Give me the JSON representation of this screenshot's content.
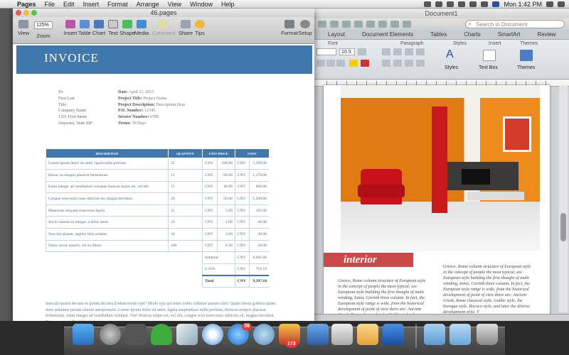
{
  "menubar": {
    "app": "Pages",
    "items": [
      "File",
      "Edit",
      "Insert",
      "Format",
      "Arrange",
      "View",
      "Window",
      "Help"
    ],
    "clock": "Mon 1:42 PM"
  },
  "pages_window": {
    "title": "46.pages",
    "toolbar": {
      "view": "View",
      "zoom_value": "125%",
      "zoom": "Zoom",
      "insert": "Insert",
      "table": "Table",
      "chart": "Chart",
      "text": "Text",
      "shape": "Shape",
      "media": "Media",
      "comment": "Comment",
      "share": "Share",
      "tips": "Tips",
      "format": "Format",
      "setup": "Setup"
    },
    "invoice": {
      "title": "INVOICE",
      "to_lines": [
        "To:",
        "First Last",
        "Title",
        "Company Name",
        "1321 First Street",
        "Anytown, State ZIP"
      ],
      "meta_lines": [
        {
          "label": "Date:",
          "value": "April 12, 2013"
        },
        {
          "label": "Project Title:",
          "value": "Project Name"
        },
        {
          "label": "Project Description:",
          "value": "Description Here"
        },
        {
          "label": "P.O. Number:",
          "value": "12345"
        },
        {
          "label": "Invoice Number:",
          "value": "6789"
        },
        {
          "label": "Terms:",
          "value": "30 Days"
        }
      ],
      "headers": [
        "DESCRIPTION",
        "QUANTITY",
        "UNIT PRICE",
        "COST"
      ],
      "rows": [
        {
          "desc": "Lorem ipsum dolor sit amet, ligula nulla pretium",
          "qty": "55",
          "cur1": "CNY",
          "unit": "100.00",
          "cur2": "CNY",
          "cost": "5,500.00"
        },
        {
          "desc": "Rhonc us tempor placerat fermentum",
          "qty": "13",
          "cur1": "CNY",
          "unit": "90.00",
          "cur2": "CNY",
          "cost": "1,170.00"
        },
        {
          "desc": "Enim integer ad vestibulum volutpat rhoncus turpis est, vel elit",
          "qty": "15",
          "cur1": "CNY",
          "unit": "40.00",
          "cur2": "CNY",
          "cost": "600.00"
        },
        {
          "desc": "Congue wisi enim nunc ultricies sit, magna tincidunt",
          "qty": "24",
          "cur1": "CNY",
          "unit": "50.00",
          "cur2": "CNY",
          "cost": "1,200.00"
        },
        {
          "desc": "Maecenas aliquam maecenas ligula",
          "qty": "21",
          "cur1": "CNY",
          "unit": "5.00",
          "cur2": "CNY",
          "cost": "105.00"
        },
        {
          "desc": "Sociis mauris in integer, a dolor netus",
          "qty": "23",
          "cur1": "CNY",
          "unit": "2.00",
          "cur2": "CNY",
          "cost": "46.00"
        },
        {
          "desc": "Non dui aliquet, sagittis felis sodales",
          "qty": "10",
          "cur1": "CNY",
          "unit": "3.00",
          "cur2": "CNY",
          "cost": "30.00"
        },
        {
          "desc": "Dolor sociis mauris, vel eu libero",
          "qty": "100",
          "cur1": "CNY",
          "unit": "0.30",
          "cur2": "CNY",
          "cost": "30.00"
        }
      ],
      "subtotal_label": "Subtotal",
      "subtotal_cur": "CNY",
      "subtotal": "8,681.00",
      "tax_label": "8.25%",
      "tax_cur": "CNY",
      "tax": "716.18",
      "total_label": "Total",
      "total_cur": "CNY",
      "total": "9,397.18",
      "body_text": "Seacula quarta decima et quinta decima Eodem modo typi? Modo typi qui nunc nobis videntur parum clari. Quam littera gothica quam nunc putamus parum claram anteposuerit. Lorem ipsum dolor sit amet, ligula suspendisse nulla pretium, rhoncus tempor placerat fermentum, enim integer ad vestibulum volutpat. Nisl rhoncus turpis est, vel elit, congue wisi enim nunc ultricies sit, magna tincidunt. Duis montes, tellus lobortis lacus amet arcu et"
    }
  },
  "word_window": {
    "title": "Document1",
    "search_placeholder": "Search in Document",
    "tabs": [
      "Layout",
      "Document Elements",
      "Tables",
      "Charts",
      "SmartArt",
      "Review"
    ],
    "ribbon": {
      "font": "Font",
      "paragraph": "Paragraph",
      "styles": "Styles",
      "insert": "Insert",
      "themes": "Themes",
      "font_size": "10.5",
      "styles_btn": "Styles",
      "text_box": "Text Box",
      "themes_btn": "Themes"
    },
    "banner": "interior",
    "col_left": "Greece, Rome column structure of European style in the concept of people the most typical, see European style building the first thought of multi winding, Ionia, Corinth three column. In fact, the European style range is wide, from the historical development of point of view there are: Ancient Greek, Rome classical style, Gothic style, the baroque style, Rococo style and later",
    "col_right": "Greece, Rome column structure of European style in the concept of people the most typical, see European style building the first thought of multi winding, Ionia, Corinth three column. In fact, the European style range is wide, from the historical development of point of view there are: Ancient Greek, Rome classical style, Gothic style, the baroque style, Rococo style, and later the diverse development style. Y"
  },
  "dock": {
    "badges": {
      "appstore": "38",
      "notes": "173"
    }
  }
}
